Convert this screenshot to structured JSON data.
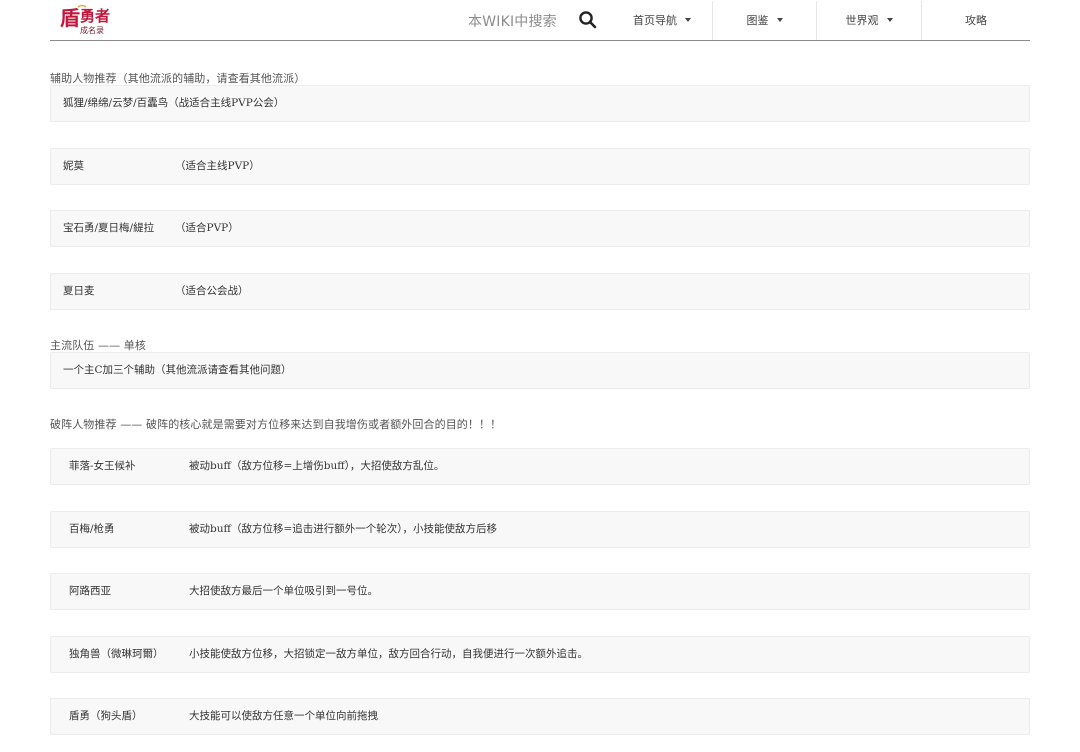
{
  "nav": {
    "logo_text": "盾勇者成名录",
    "search_label": "本WIKI中搜索",
    "items": [
      {
        "label": "首页导航",
        "dropdown": true
      },
      {
        "label": "图鉴",
        "dropdown": true
      },
      {
        "label": "世界观",
        "dropdown": true
      },
      {
        "label": "攻略",
        "dropdown": false
      }
    ]
  },
  "sections": {
    "support": {
      "title": "辅助人物推荐（其他流派的辅助，请查看其他流派）",
      "rows": [
        {
          "name": "狐狸/绵绵/云梦/百蠹鸟（战适合主线PVP公会）",
          "desc": ""
        },
        {
          "name": "妮莫",
          "desc": "（适合主线PVP）"
        },
        {
          "name": "宝石勇/夏日梅/緹拉",
          "desc": "（适合PVP）"
        },
        {
          "name": "夏日麦",
          "desc": "（适合公会战）"
        }
      ]
    },
    "mainstream": {
      "title": "主流队伍 —— 单核",
      "rows": [
        {
          "name": "一个主C加三个辅助（其他流派请查看其他问题）",
          "desc": ""
        }
      ]
    },
    "breaker": {
      "title": "破阵人物推荐 —— 破阵的核心就是需要对方位移来达到自我增伤或者额外回合的目的！！！",
      "rows": [
        {
          "name": "菲落-女王候补",
          "desc": "被动buff（敌方位移=上增伤buff），大招使敌方乱位。"
        },
        {
          "name": "百梅/枪勇",
          "desc": "被动buff（敌方位移=追击进行额外一个轮次），小技能使敌方后移"
        },
        {
          "name": "阿路西亚",
          "desc": "大招使敌方最后一个单位吸引到一号位。"
        },
        {
          "name": "独角兽（微琳珂爾）",
          "desc": "小技能使敌方位移，大招锁定一敌方单位，敌方回合行动，自我便进行一次额外追击。"
        },
        {
          "name": "盾勇（狗头盾）",
          "desc": "大技能可以使敌方任意一个单位向前拖拽"
        }
      ]
    }
  },
  "colors": {
    "row_bg": "#f8f8f8",
    "row_border": "#ececec",
    "logo_red": "#c0163b",
    "nav_border": "#8a8a8a"
  }
}
